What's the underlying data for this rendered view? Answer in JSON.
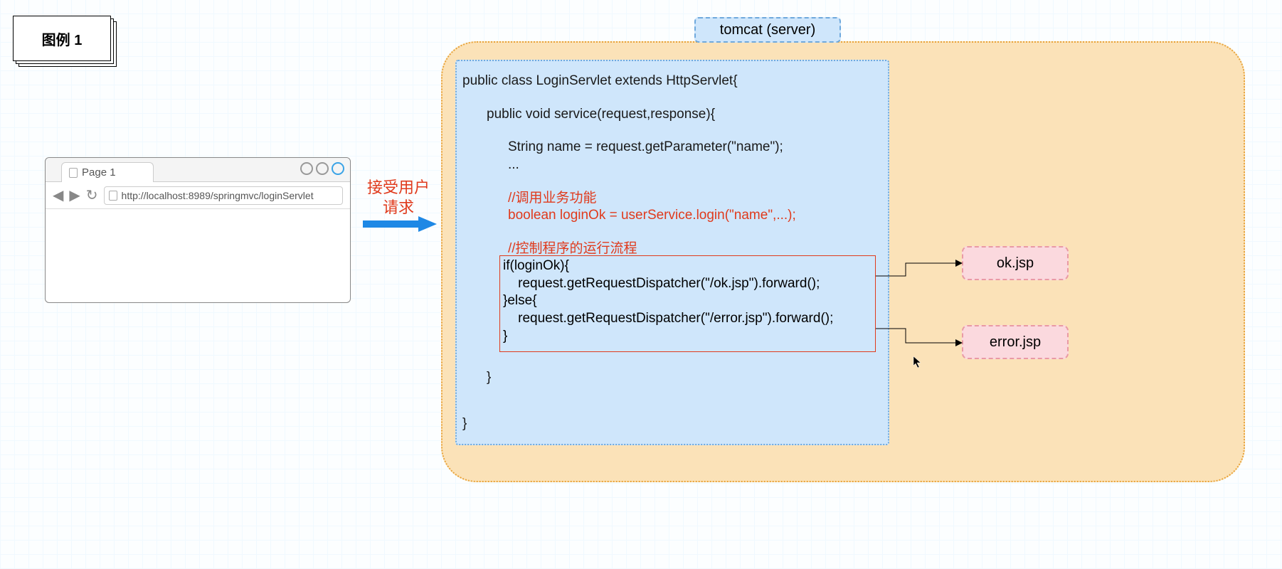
{
  "legend": {
    "title": "图例 1"
  },
  "browser": {
    "tab_label": "Page 1",
    "url": "http://localhost:8989/springmvc/loginServlet"
  },
  "arrow": {
    "label_line1": "接受用户",
    "label_line2": "请求"
  },
  "tomcat": {
    "label": "tomcat (server)"
  },
  "code": {
    "line1": "public class LoginServlet extends HttpServlet{",
    "line2": "public void service(request,response){",
    "line3": "String name = request.getParameter(\"name\");",
    "line4": "...",
    "comment_biz": "//调用业务功能",
    "line5": "boolean loginOk = userService.login(\"name\",...);",
    "comment_flow": "//控制程序的运行流程",
    "flow_if": "if(loginOk){",
    "flow_ok": "    request.getRequestDispatcher(\"/ok.jsp\").forward();",
    "flow_else": "}else{",
    "flow_err": "    request.getRequestDispatcher(\"/error.jsp\").forward();",
    "flow_end": "}",
    "close_service": "}",
    "close_class": "}"
  },
  "nodes": {
    "ok": "ok.jsp",
    "error": "error.jsp"
  }
}
